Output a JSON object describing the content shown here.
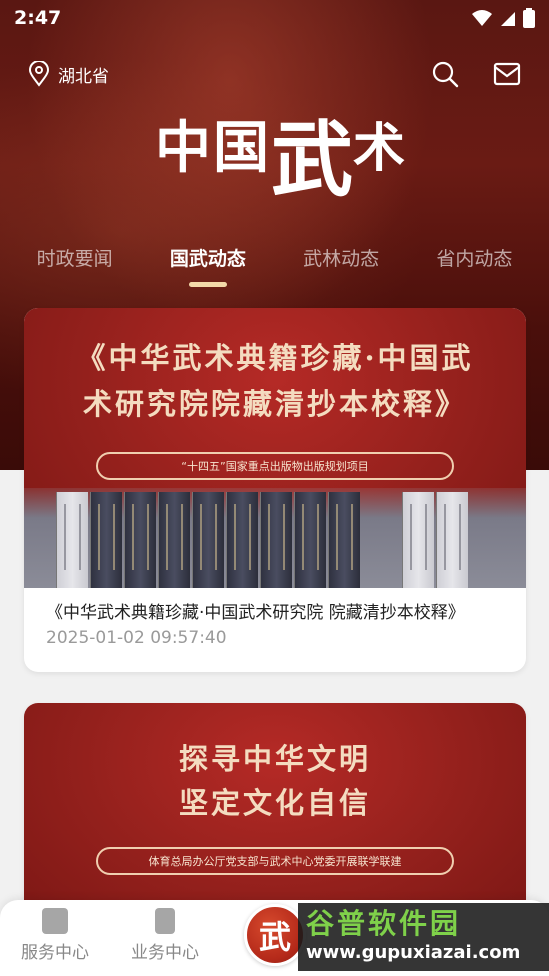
{
  "status_bar": {
    "time": "2:47"
  },
  "header": {
    "location": "湖北省",
    "logo_chars": [
      "中国",
      "武",
      "术"
    ]
  },
  "tabs": [
    {
      "label": "时政要闻",
      "active": false
    },
    {
      "label": "国武动态",
      "active": true
    },
    {
      "label": "武林动态",
      "active": false
    },
    {
      "label": "省内动态",
      "active": false
    }
  ],
  "articles": [
    {
      "banner_line1": "《中华武术典籍珍藏·中国武",
      "banner_line2": "术研究院院藏清抄本校释》",
      "banner_pill": "“十四五”国家重点出版物出版规划项目",
      "title": "《中华武术典籍珍藏·中国武术研究院 院藏清抄本校释》",
      "date": "2025-01-02 09:57:40"
    },
    {
      "banner_line1": "探寻中华文明",
      "banner_line2": "坚定文化自信",
      "banner_pill": "体育总局办公厅党支部与武术中心党委开展联学联建"
    }
  ],
  "bottom_nav": {
    "items": [
      {
        "label": "服务中心"
      },
      {
        "label": "业务中心"
      }
    ],
    "center_char": "武"
  },
  "watermark": {
    "cn": "谷普软件园",
    "url": "www.gupuxiazai.com"
  },
  "colors": {
    "header_red": "#5a1712",
    "tab_indicator": "#f3d9a9",
    "banner_red": "#93201c"
  }
}
